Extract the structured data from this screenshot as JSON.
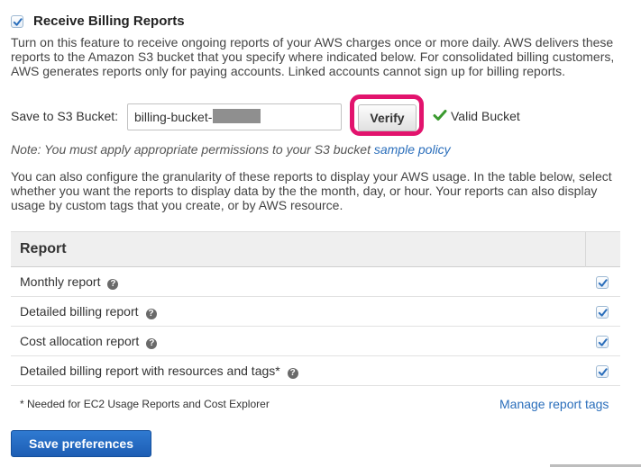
{
  "billing": {
    "enabled": true,
    "title": "Receive Billing Reports",
    "description": "Turn on this feature to receive ongoing reports of your AWS charges once or more daily. AWS delivers these reports to the Amazon S3 bucket that you specify where indicated below. For consolidated billing customers, AWS generates reports only for paying accounts. Linked accounts cannot sign up for billing reports."
  },
  "s3": {
    "label": "Save to S3 Bucket:",
    "bucket_value": "billing-bucket-",
    "verify_label": "Verify",
    "status_text": "Valid Bucket"
  },
  "note": {
    "text": "Note: You must apply appropriate permissions to your S3 bucket ",
    "link": "sample policy"
  },
  "granularity_text": "You can also configure the granularity of these reports to display your AWS usage. In the table below, select whether you want the reports to display data by the the month, day, or hour. Your reports can also display usage by custom tags that you create, or by AWS resource.",
  "table": {
    "header": "Report",
    "rows": [
      {
        "label": "Monthly report",
        "checked": true
      },
      {
        "label": "Detailed billing report",
        "checked": true
      },
      {
        "label": "Cost allocation report",
        "checked": true
      },
      {
        "label": "Detailed billing report with resources and tags*",
        "checked": true
      }
    ]
  },
  "footnote": "* Needed for EC2 Usage Reports and Cost Explorer",
  "manage_tags_link": "Manage report tags",
  "save_label": "Save preferences",
  "colors": {
    "primary_button": "#1d5eb4",
    "highlight": "#e2136d",
    "link": "#2a6ebb",
    "valid": "#3a9a2f",
    "checkmark": "#2a6ebb"
  },
  "icons": {
    "checkbox_check": "checkmark-icon",
    "help": "help-icon",
    "valid": "valid-check-icon"
  }
}
